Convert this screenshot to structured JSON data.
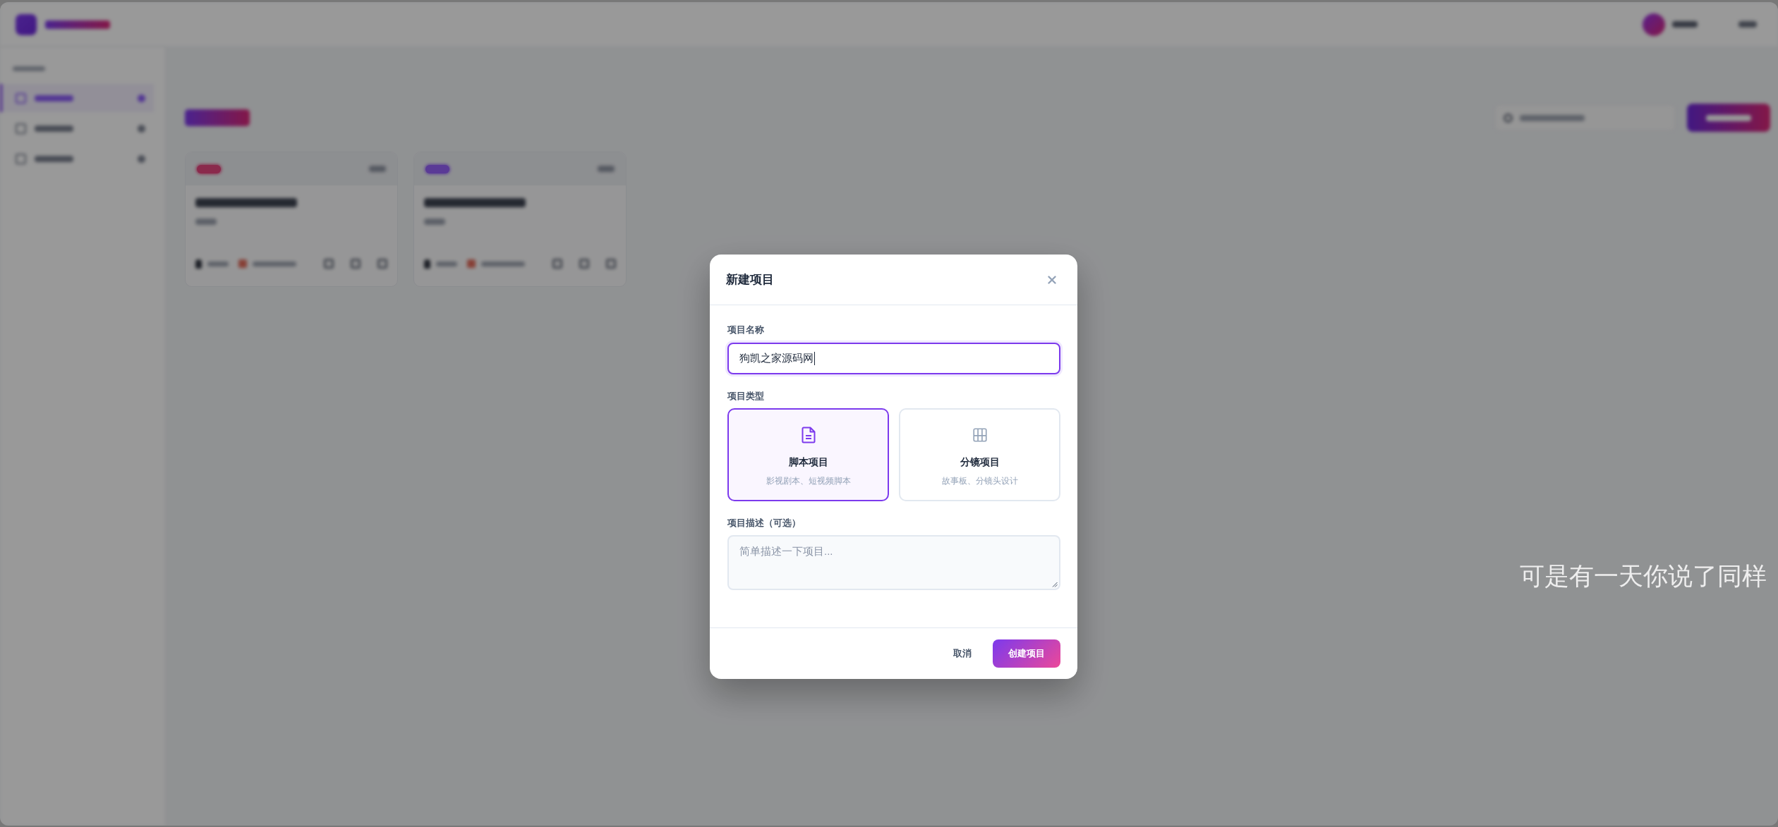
{
  "app_background": {
    "sidebar_items": [
      {
        "selected": true
      },
      {
        "selected": false
      },
      {
        "selected": false
      }
    ],
    "project_cards": [
      {
        "color": "#8a2a4c"
      },
      {
        "color": "#5a3a96"
      }
    ]
  },
  "dialog": {
    "title": "新建项目",
    "name_field": {
      "label": "项目名称",
      "value": "狗凯之家源码网",
      "focused": true
    },
    "type_field": {
      "label": "项目类型",
      "options": [
        {
          "kind": "document",
          "title": "脚本项目",
          "subtitle": "影视剧本、短视频脚本",
          "selected": true
        },
        {
          "kind": "grid",
          "title": "分镜项目",
          "subtitle": "故事板、分镜头设计",
          "selected": false
        }
      ]
    },
    "description_field": {
      "label": "项目描述（可选）",
      "placeholder": "简单描述一下项目..."
    },
    "buttons": [
      {
        "kind": "cancel",
        "label": "取消"
      },
      {
        "kind": "primary",
        "label": "创建项目"
      }
    ]
  },
  "subtitle": "可是有一天你说了同样"
}
